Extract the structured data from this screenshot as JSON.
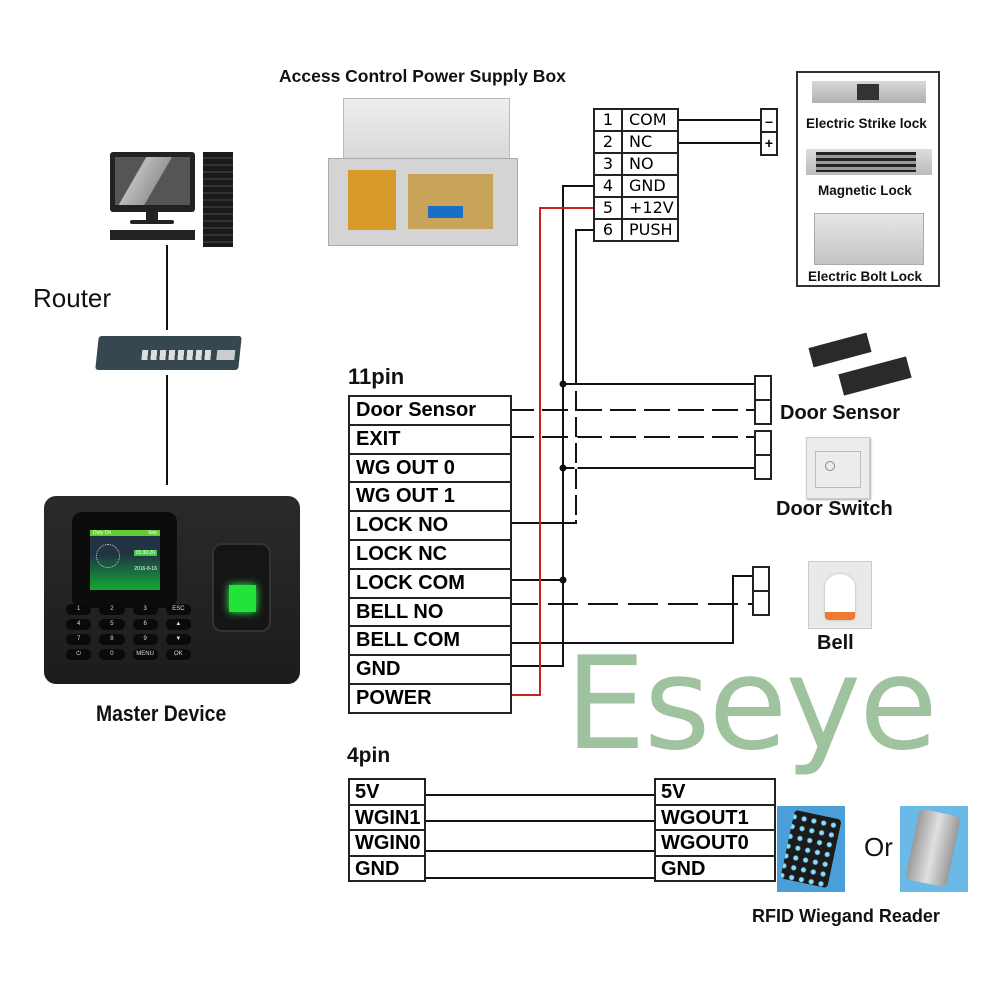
{
  "titles": {
    "power_supply_box": "Access Control Power Supply Box",
    "router": "Router",
    "master_device": "Master Device",
    "pin11_header": "11pin",
    "pin4_header": "4pin",
    "watermark": "Eseye"
  },
  "power_supply_terminals": [
    {
      "num": "1",
      "label": "COM"
    },
    {
      "num": "2",
      "label": "NC"
    },
    {
      "num": "3",
      "label": "NO"
    },
    {
      "num": "4",
      "label": "GND"
    },
    {
      "num": "5",
      "label": "+12V"
    },
    {
      "num": "6",
      "label": "PUSH"
    }
  ],
  "lock_terminal": {
    "minus": "–",
    "plus": "+"
  },
  "locks": [
    {
      "label": "Electric Strike lock"
    },
    {
      "label": "Magnetic Lock"
    },
    {
      "label": "Electric Bolt Lock"
    }
  ],
  "pin11": [
    "Door Sensor",
    "EXIT",
    "WG OUT 0",
    "WG OUT 1",
    "LOCK NO",
    "LOCK NC",
    "LOCK COM",
    "BELL NO",
    "BELL COM",
    "GND",
    "POWER"
  ],
  "peripherals": {
    "door_sensor": "Door Sensor",
    "door_switch": "Door Switch",
    "bell": "Bell"
  },
  "pin4_device": [
    "5V",
    "WGIN1",
    "WGIN0",
    "GND"
  ],
  "pin4_reader": [
    "5V",
    "WGOUT1",
    "WGOUT0",
    "GND"
  ],
  "reader": {
    "or_label": "Or",
    "caption": "RFID Wiegand Reader"
  },
  "device_screen": {
    "header_left": "Duty On",
    "header_right": "Sep",
    "time": "15:30:26",
    "date": "2016-8-16"
  },
  "keypad": [
    "1",
    "2",
    "3",
    "ESC",
    "4",
    "5",
    "6",
    "▲",
    "7",
    "8",
    "9",
    "▼",
    "⏻",
    "0",
    "MENU",
    "OK"
  ],
  "colors": {
    "wire": "#111111",
    "power_wire": "#cc1f1f",
    "watermark": "#9ec39e",
    "fingerprint": "#22e33a"
  }
}
